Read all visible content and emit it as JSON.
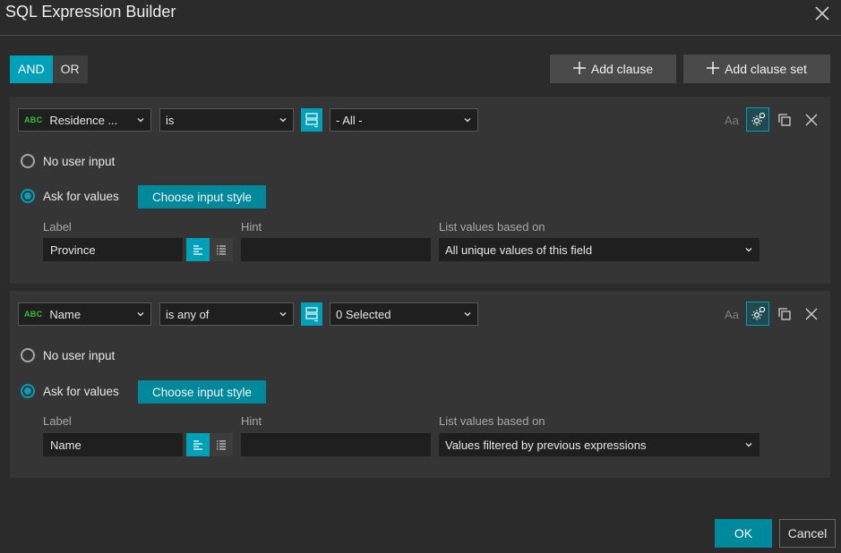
{
  "dialog": {
    "title": "SQL Expression Builder"
  },
  "logic": {
    "and_label": "AND",
    "or_label": "OR",
    "selected": "AND"
  },
  "actions": {
    "add_clause": "Add clause",
    "add_clause_set": "Add clause set"
  },
  "clauses": [
    {
      "field_type": "ABC",
      "field": "Residence ...",
      "operator": "is",
      "value": "- All -",
      "case_label": "Aa",
      "no_user_input": "No user input",
      "ask_for_values": "Ask for values",
      "input_mode": "Ask for values",
      "choose_input_style": "Choose input style",
      "label_caption": "Label",
      "label_value": "Province",
      "hint_caption": "Hint",
      "hint_value": "",
      "list_caption": "List values based on",
      "list_value": "All unique values of this field"
    },
    {
      "field_type": "ABC",
      "field": "Name",
      "operator": "is any of",
      "value": "0 Selected",
      "case_label": "Aa",
      "no_user_input": "No user input",
      "ask_for_values": "Ask for values",
      "input_mode": "Ask for values",
      "choose_input_style": "Choose input style",
      "label_caption": "Label",
      "label_value": "Name",
      "hint_caption": "Hint",
      "hint_value": "",
      "list_caption": "List values based on",
      "list_value": "Values filtered by previous expressions"
    }
  ],
  "footer": {
    "ok": "OK",
    "cancel": "Cancel"
  },
  "colors": {
    "accent": "#00a0b8",
    "background": "#2b2b2b",
    "panel": "#353535",
    "field_type": "#35c13b"
  }
}
